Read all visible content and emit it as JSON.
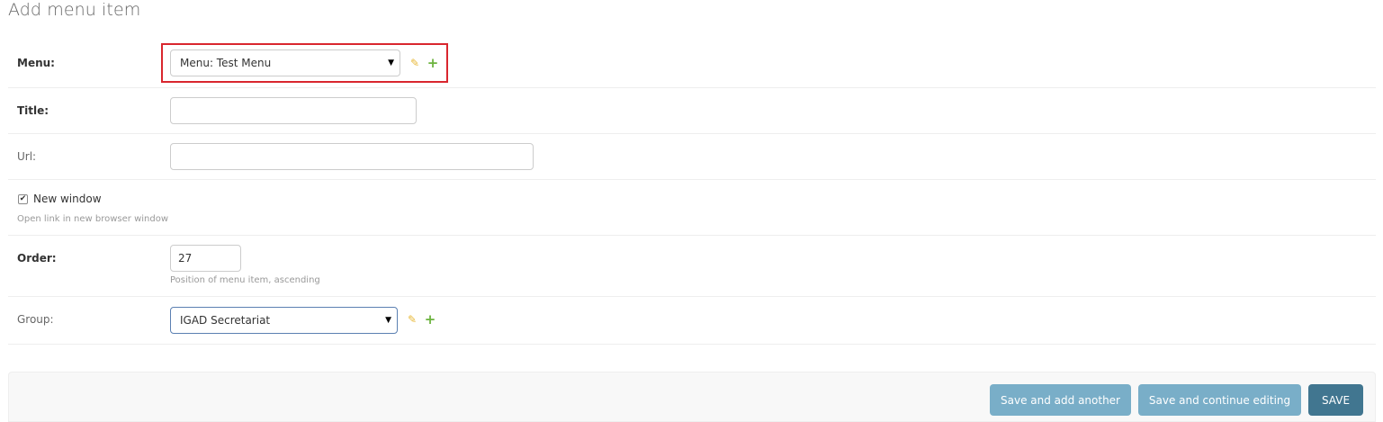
{
  "page": {
    "title": "Add menu item"
  },
  "form": {
    "menu": {
      "label": "Menu:",
      "selected": "Menu: Test Menu",
      "edit_icon": "pencil-icon",
      "add_icon": "plus-icon"
    },
    "title": {
      "label": "Title:",
      "value": ""
    },
    "url": {
      "label": "Url:",
      "value": ""
    },
    "new_window": {
      "label": "New window",
      "checked": true,
      "checkmark": "✔",
      "help": "Open link in new browser window"
    },
    "order": {
      "label": "Order:",
      "value": "27",
      "help": "Position of menu item, ascending"
    },
    "group": {
      "label": "Group:",
      "selected": "IGAD Secretariat",
      "edit_icon": "pencil-icon",
      "add_icon": "plus-icon"
    }
  },
  "icons": {
    "pencil": "✎",
    "plus": "+",
    "caret": "▼"
  },
  "submit": {
    "save_add_another": "Save and add another",
    "save_continue": "Save and continue editing",
    "save": "SAVE"
  },
  "colors": {
    "highlight": "#d9262e",
    "primary_button": "#417690",
    "secondary_button": "#79aec8",
    "pencil": "#e8b93a",
    "plus": "#6cb33e"
  }
}
